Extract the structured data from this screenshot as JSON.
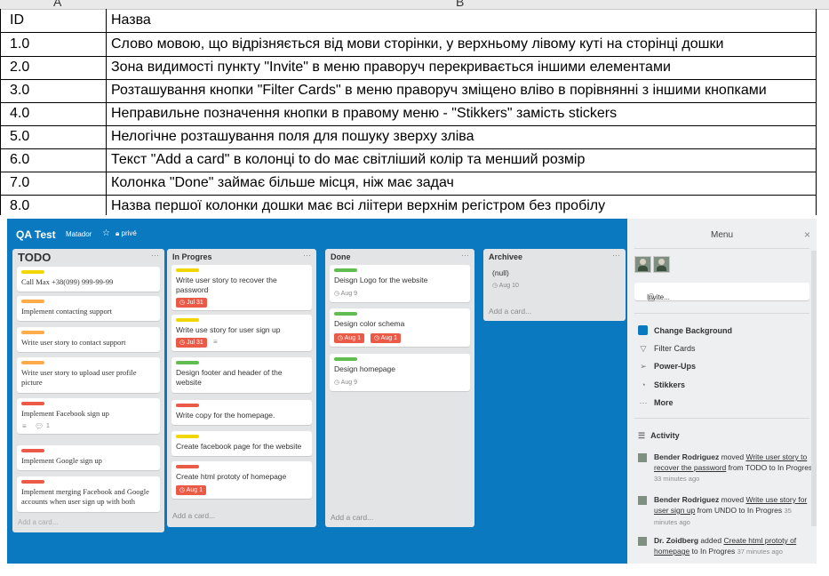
{
  "sheet": {
    "col_a": "A",
    "col_b": "B",
    "rows": [
      {
        "id": "ID",
        "text": "Назва"
      },
      {
        "id": "1.0",
        "text": "Слово мовою, що відрізняється від мови сторінки, у верхньому лівому куті на сторінці дошки"
      },
      {
        "id": "2.0",
        "text": "Зона видимості пункту \"Invite\" в меню праворуч перекривається іншими елементами"
      },
      {
        "id": "3.0",
        "text": "Розташування кнопки \"Filter Cards\" в меню праворуч зміщено вліво в порівнянні з іншими кнопками"
      },
      {
        "id": "4.0",
        "text": "Неправильне позначення кнопки в правому меню - \"Stikkers\" замість stickers"
      },
      {
        "id": "5.0",
        "text": "Нелогічне розташування поля для пошуку зверху зліва"
      },
      {
        "id": "6.0",
        "text": "Текст \"Add a card\" в колонці to do має світліший колір та менший розмір"
      },
      {
        "id": "7.0",
        "text": "Колонка \"Done\" займає більше місця, ніж має задач"
      },
      {
        "id": "8.0",
        "text": "Назва першої колонки дошки має всі ліітери верхнім регістром без пробілу"
      }
    ]
  },
  "board": {
    "title": "QA Test",
    "team": "Matador",
    "privacy": "privé",
    "lists": {
      "todo": {
        "title": "TODO",
        "add": "Add a card...",
        "cards": [
          {
            "text": "Call Max +38(099) 999-99-99",
            "color": "#f2d600"
          },
          {
            "text": "Implement contacting support",
            "color": "#ffab4a"
          },
          {
            "text": "Write user story to contact support",
            "color": "#ffab4a"
          },
          {
            "text": "Write user story to upload user profile picture",
            "color": "#ffab4a"
          },
          {
            "text": "Implement Facebook sign up",
            "color": "#eb5a46",
            "comments": "1"
          },
          {
            "text": "Implement Google sign up",
            "color": "#eb5a46"
          },
          {
            "text": "Implement merging Facebook and Google accounts when user sign up with both",
            "color": "#eb5a46"
          }
        ]
      },
      "progress": {
        "title": "In Progres",
        "add": "Add a card...",
        "cards": [
          {
            "text": "Write user story to recover the password",
            "color": "#f2d600",
            "due": "Jul 31"
          },
          {
            "text": "Write use story for user sign up",
            "color": "#f2d600",
            "due": "Jul 31"
          },
          {
            "text": "Design footer and header of the website",
            "color": "#61bd4f"
          },
          {
            "text": "Write copy for the homepage.",
            "color": "#eb5a46"
          },
          {
            "text": "Create facebook page for the website",
            "color": "#f2d600"
          },
          {
            "text": "Create html prototy of homepage",
            "color": "#eb5a46",
            "due": "Aug 1"
          }
        ]
      },
      "done": {
        "title": "Done",
        "add": "Add a card...",
        "cards": [
          {
            "text": "Deisgn Logo for the website",
            "color": "#61bd4f",
            "due": "Aug 9"
          },
          {
            "text": "Design color schema",
            "color": "#61bd4f",
            "due": "Aug 1",
            "due2": "Aug 1"
          },
          {
            "text": "Design homepage",
            "color": "#61bd4f",
            "due": "Aug 9"
          }
        ]
      },
      "archive": {
        "title": "Archivee",
        "add": "Add a card...",
        "cards": [
          {
            "text": "(null)",
            "due": "Aug 10"
          }
        ]
      }
    },
    "menu": {
      "title": "Menu",
      "close": "×",
      "invite": "Invite...",
      "items": [
        "Change Background",
        "Filter Cards",
        "Power-Ups",
        "Stikkers",
        "More"
      ],
      "activity_title": "Activity",
      "activity": [
        {
          "user": "Bender Rodriguez",
          "verb": " moved ",
          "card": "Write user story to recover the password",
          "rest": " from TODO to In Progres",
          "time": "33 minutes ago"
        },
        {
          "user": "Bender Rodriguez",
          "verb": " moved ",
          "card": "Write use story for user sign up",
          "rest": " from UNDO to In Progres",
          "time": "35 minutes ago"
        },
        {
          "user": "Dr. Zoidberg",
          "verb": " added ",
          "card": "Create html prototy of homepage",
          "rest": " to In Progres",
          "time": "37 minutes ago"
        }
      ]
    }
  }
}
